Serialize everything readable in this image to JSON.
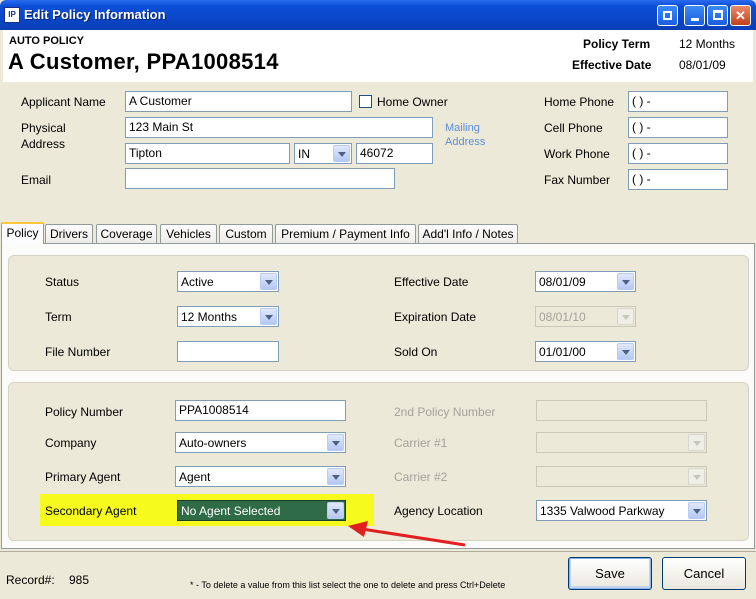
{
  "window": {
    "title": "Edit Policy Information",
    "logo_text": "IP"
  },
  "header": {
    "policy_type": "AUTO POLICY",
    "customer_policy": "A Customer, PPA1008514",
    "policy_term_label": "Policy Term",
    "policy_term_value": "12 Months",
    "effective_date_label": "Effective Date",
    "effective_date_value": "08/01/09"
  },
  "applicant": {
    "name_label": "Applicant Name",
    "name_value": "A Customer",
    "home_owner_label": "Home Owner",
    "address_label_1": "Physical",
    "address_label_2": "Address",
    "street_value": "123 Main St",
    "city_value": "Tipton",
    "state_value": "IN",
    "zip_value": "46072",
    "mailing_link_1": "Mailing",
    "mailing_link_2": "Address",
    "email_label": "Email",
    "email_value": "",
    "home_phone_label": "Home Phone",
    "home_phone_value": "(   )   -",
    "cell_phone_label": "Cell Phone",
    "cell_phone_value": "(   )   -",
    "work_phone_label": "Work Phone",
    "work_phone_value": "(   )   -",
    "fax_label": "Fax Number",
    "fax_value": "(   )   -"
  },
  "tabs": [
    "Policy",
    "Drivers",
    "Coverage",
    "Vehicles",
    "Custom",
    "Premium / Payment Info",
    "Add'l Info / Notes"
  ],
  "policy": {
    "status_label": "Status",
    "status_value": "Active",
    "term_label": "Term",
    "term_value": "12 Months",
    "file_number_label": "File Number",
    "file_number_value": "",
    "effective_date_label": "Effective Date",
    "effective_date_value": "08/01/09",
    "expiration_date_label": "Expiration Date",
    "expiration_date_value": "08/01/10",
    "sold_on_label": "Sold On",
    "sold_on_value": "01/01/00",
    "policy_number_label": "Policy Number",
    "policy_number_value": "PPA1008514",
    "company_label": "Company",
    "company_value": "Auto-owners",
    "primary_agent_label": "Primary Agent",
    "primary_agent_value": "Agent",
    "secondary_agent_label": "Secondary Agent",
    "secondary_agent_value": "No Agent Selected",
    "second_policy_label": "2nd Policy Number",
    "second_policy_value": "",
    "carrier1_label": "Carrier #1",
    "carrier1_value": "",
    "carrier2_label": "Carrier #2",
    "carrier2_value": "",
    "agency_location_label": "Agency Location",
    "agency_location_value": "1335 Valwood Parkway"
  },
  "footer": {
    "record_label": "Record#:",
    "record_value": "985",
    "note": "* - To delete a value from this list select the one to delete and press Ctrl+Delete",
    "save_label": "Save",
    "cancel_label": "Cancel"
  },
  "colors": {
    "title_bar": "#0a46c8",
    "highlight": "#f6fb1d",
    "arrow": "#e02020",
    "selected_dropdown": "#2f6b46"
  }
}
